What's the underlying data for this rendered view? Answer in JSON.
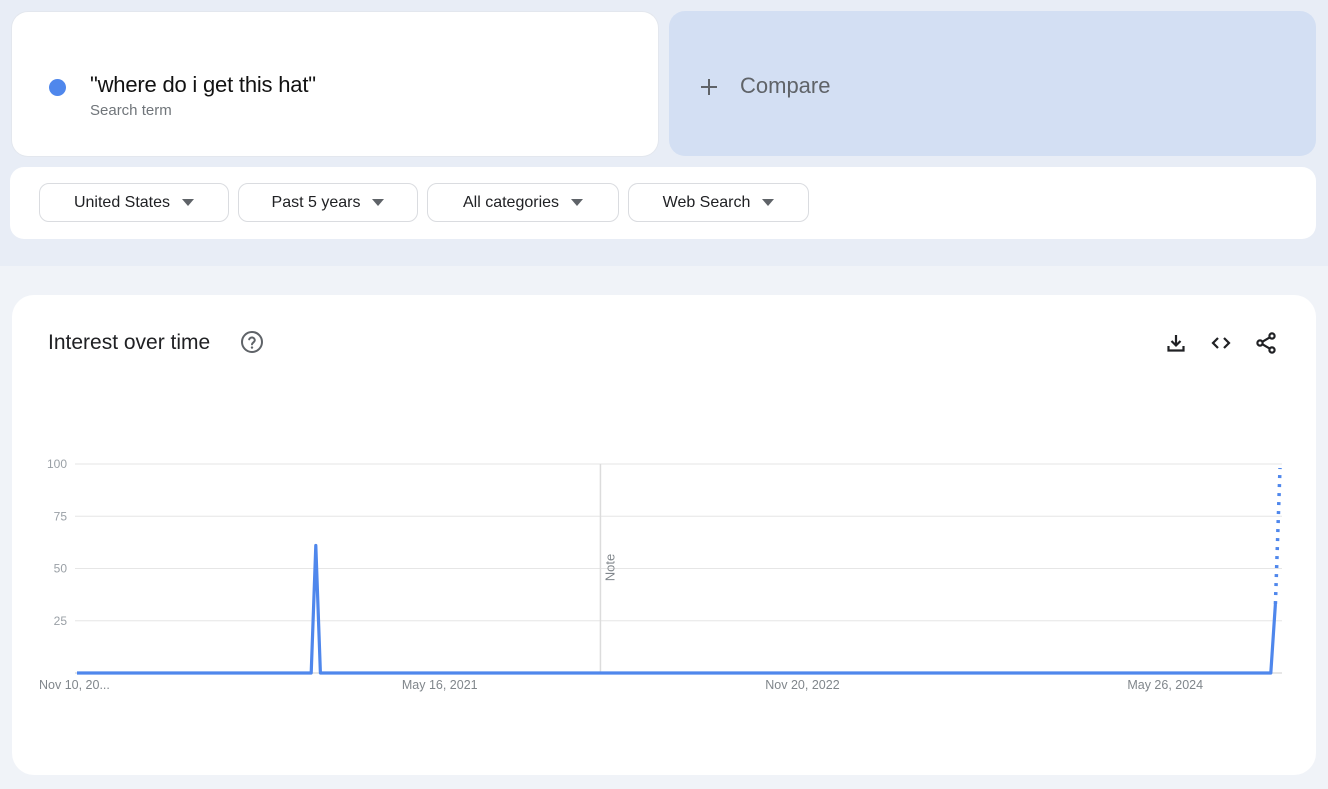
{
  "search_term": {
    "label": "\"where do i get this hat\"",
    "sublabel": "Search term",
    "color": "#4f87ec"
  },
  "compare": {
    "icon": "plus-icon",
    "label": "Compare"
  },
  "filters": [
    {
      "label": "United States",
      "icon": "caret-down-icon"
    },
    {
      "label": "Past 5 years",
      "icon": "caret-down-icon"
    },
    {
      "label": "All categories",
      "icon": "caret-down-icon"
    },
    {
      "label": "Web Search",
      "icon": "caret-down-icon"
    }
  ],
  "panel": {
    "title": "Interest over time",
    "help_icon": "help-circle-icon",
    "actions": [
      {
        "name": "download",
        "icon": "download-icon"
      },
      {
        "name": "embed",
        "icon": "code-icon"
      },
      {
        "name": "share",
        "icon": "share-icon"
      }
    ]
  },
  "chart_data": {
    "type": "line",
    "title": "Interest over time",
    "xlabel": "",
    "ylabel": "",
    "ylim": [
      0,
      100
    ],
    "yticks": [
      25,
      50,
      75,
      100
    ],
    "xtick_labels": [
      "Nov 10, 20...",
      "May 16, 2021",
      "Nov 20, 2022",
      "May 26, 2024"
    ],
    "x_range_weeks": [
      0,
      262
    ],
    "xtick_weeks": [
      0,
      79,
      158,
      237
    ],
    "grid": true,
    "legend": "none",
    "series_color": "#4f87ec",
    "annotation": {
      "label": "Note",
      "week": 114
    },
    "series": [
      {
        "name": "\"where do i get this hat\"",
        "points": [
          {
            "week": 0,
            "value": 0
          },
          {
            "week": 51,
            "value": 0
          },
          {
            "week": 52,
            "value": 61
          },
          {
            "week": 53,
            "value": 0
          },
          {
            "week": 260,
            "value": 0
          },
          {
            "week": 261,
            "value": 33
          }
        ],
        "partial": {
          "from": {
            "week": 261,
            "value": 33
          },
          "to": {
            "week": 262,
            "value": 100
          }
        }
      }
    ]
  }
}
